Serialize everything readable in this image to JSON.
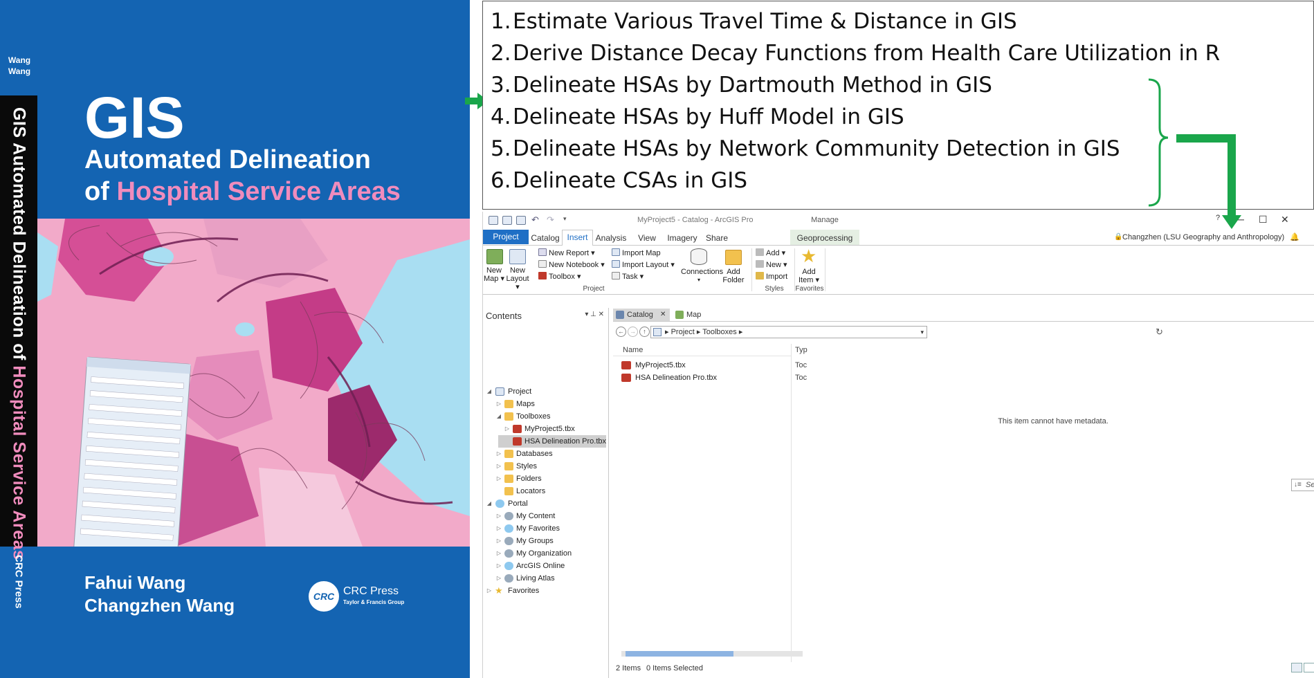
{
  "book": {
    "spine_author_1": "Wang",
    "spine_author_2": "Wang",
    "spine_title_main": "GIS Automated Delineation of ",
    "spine_title_pink": "Hospital Service Areas",
    "spine_publisher": "CRC Press",
    "title_big": "GIS",
    "subtitle_line1": "Automated Delineation",
    "subtitle_of": "of ",
    "subtitle_pink": "Hospital Service Areas",
    "author_1": "Fahui Wang",
    "author_2": "Changzhen Wang",
    "publisher_logo": "CRC",
    "publisher_name": "CRC Press",
    "publisher_tag": "Taylor & Francis Group",
    "colors": {
      "cover_blue": "#1464b2",
      "pink": "#f08cbd",
      "map_water": "#a9def2"
    }
  },
  "steps": [
    {
      "num": "1.",
      "text": "Estimate Various Travel Time & Distance in GIS"
    },
    {
      "num": "2.",
      "text": "Derive Distance Decay Functions from Health Care Utilization in R"
    },
    {
      "num": "3.",
      "text": "Delineate HSAs by Dartmouth Method in GIS"
    },
    {
      "num": "4.",
      "text": "Delineate HSAs by Huff Model in GIS"
    },
    {
      "num": "5.",
      "text": "Delineate HSAs by Network Community Detection in GIS"
    },
    {
      "num": "6.",
      "text": "Delineate CSAs in GIS"
    }
  ],
  "annotation_color": "#1aa64b",
  "window": {
    "title": "MyProject5 - Catalog - ArcGIS Pro",
    "contextual_group": "Manage",
    "help": "?",
    "min": "─",
    "max": "☐",
    "close": "✕",
    "user": "Changzhen (LSU Geography and Anthropology)",
    "tabs": {
      "project": "Project",
      "catalog": "Catalog",
      "insert": "Insert",
      "analysis": "Analysis",
      "view": "View",
      "imagery": "Imagery",
      "share": "Share",
      "geoprocessing": "Geoprocessing"
    }
  },
  "ribbon": {
    "new_map_1": "New",
    "new_map_2": "Map ▾",
    "new_layout_1": "New",
    "new_layout_2": "Layout ▾",
    "new_report": "New Report ▾",
    "new_notebook": "New Notebook ▾",
    "toolbox": "Toolbox ▾",
    "import_map": "Import Map",
    "import_layout": "Import Layout ▾",
    "task": "Task ▾",
    "connections": "Connections",
    "connections_arrow": "▾",
    "add_folder_1": "Add",
    "add_folder_2": "Folder",
    "add": "Add ▾",
    "new": "New ▾",
    "import": "Import",
    "add_item_1": "Add",
    "add_item_2": "Item ▾",
    "group_project": "Project",
    "group_styles": "Styles",
    "group_favorites": "Favorites"
  },
  "contents": {
    "title": "Contents",
    "controls": "▾ ⊥ ✕",
    "items": {
      "project": "Project",
      "maps": "Maps",
      "toolboxes": "Toolboxes",
      "myproject_tbx": "MyProject5.tbx",
      "hsa_tbx": "HSA Delineation Pro.tbx",
      "databases": "Databases",
      "styles": "Styles",
      "folders": "Folders",
      "locators": "Locators",
      "portal": "Portal",
      "my_content": "My Content",
      "my_favorites": "My Favorites",
      "my_groups": "My Groups",
      "my_organization": "My Organization",
      "arcgis_online": "ArcGIS Online",
      "living_atlas": "Living Atlas",
      "favorites": "Favorites"
    }
  },
  "catalog": {
    "tab_catalog": "Catalog",
    "tab_catalog_close": "✕",
    "tab_map": "Map",
    "path": "▸  Project  ▸  Toolboxes  ▸",
    "search_placeholder": "Search Toolboxes",
    "col_name": "Name",
    "col_type": "Typ",
    "files": [
      {
        "name": "MyProject5.tbx",
        "type": "Toc"
      },
      {
        "name": "HSA Delineation Pro.tbx",
        "type": "Toc"
      }
    ],
    "metadata_message": "This item cannot have metadata.",
    "status_items": "2 Items",
    "status_selected": "0 Items Selected"
  }
}
